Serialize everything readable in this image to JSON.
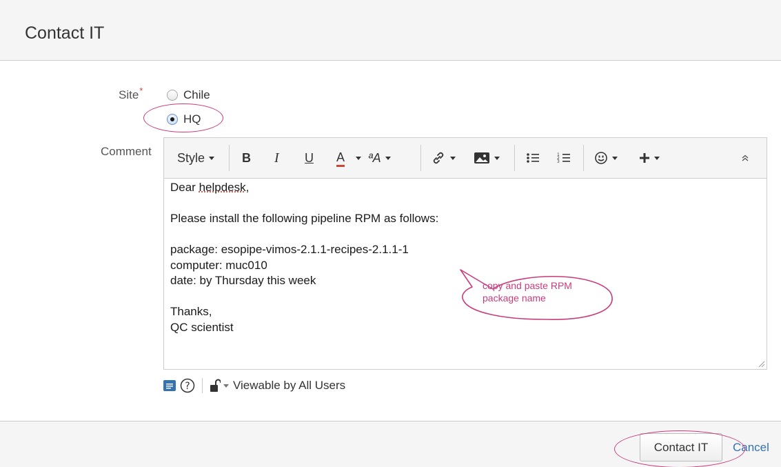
{
  "header": {
    "title": "Contact IT"
  },
  "form": {
    "site_label": "Site",
    "required_mark": "*",
    "site_options": [
      {
        "label": "Chile",
        "checked": false
      },
      {
        "label": "HQ",
        "checked": true
      }
    ],
    "comment_label": "Comment"
  },
  "toolbar": {
    "style_label": "Style",
    "bold": "B",
    "italic": "I",
    "underline": "U",
    "text_color": "A",
    "text_effects": "ªA"
  },
  "comment_lines": [
    "Dear helpdesk,",
    "",
    "Please install the following pipeline RPM as follows:",
    "",
    "package: esopipe-vimos-2.1.1-recipes-2.1.1-1",
    "computer: muc010",
    "date: by Thursday this week",
    "",
    "Thanks,",
    "QC scientist"
  ],
  "spell_word": "helpdesk",
  "visibility": {
    "label": "Viewable by All Users"
  },
  "actions": {
    "submit_label": "Contact IT",
    "cancel_label": "Cancel"
  },
  "annotations": {
    "callout_text": "copy and paste RPM\npackage name"
  },
  "colors": {
    "annotation": "#c83c7c",
    "link": "#3572b0",
    "required": "#d04437",
    "underline_color_bar": "#d04437"
  }
}
